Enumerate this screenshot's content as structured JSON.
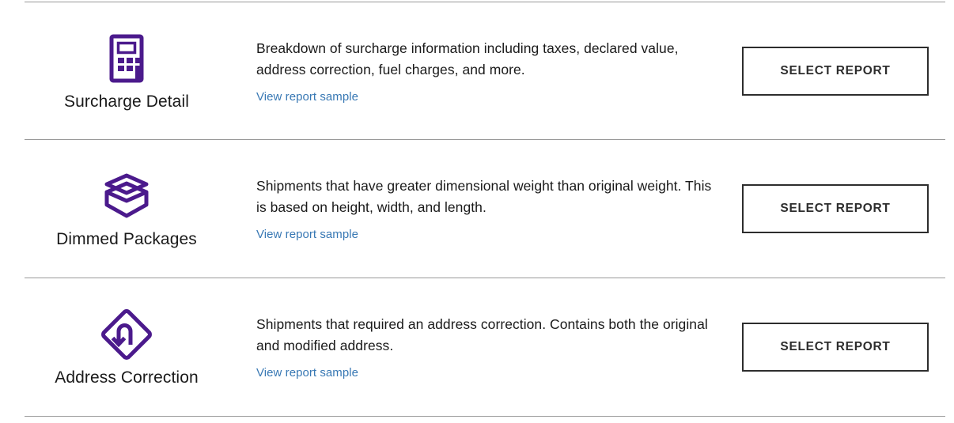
{
  "theme": {
    "accent_purple": "#4B1A8C",
    "link_blue": "#3878b4",
    "button_border": "#2d2d2d",
    "divider": "#999999",
    "text": "#1a1a1a"
  },
  "reports": [
    {
      "icon": "calculator-icon",
      "name": "Surcharge Detail",
      "description": "Breakdown of surcharge information including taxes, declared value, address correction, fuel charges, and more.",
      "sample_link": "View report sample",
      "action_label": "SELECT REPORT"
    },
    {
      "icon": "open-box-icon",
      "name": "Dimmed Packages",
      "description": "Shipments that have greater dimensional weight than original weight. This is based on height, width, and length.",
      "sample_link": "View report sample",
      "action_label": "SELECT REPORT"
    },
    {
      "icon": "address-correction-uturn-icon",
      "name": "Address Correction",
      "description": "Shipments that required an address correction. Contains both the original and modified address.",
      "sample_link": "View report sample",
      "action_label": "SELECT REPORT"
    }
  ]
}
